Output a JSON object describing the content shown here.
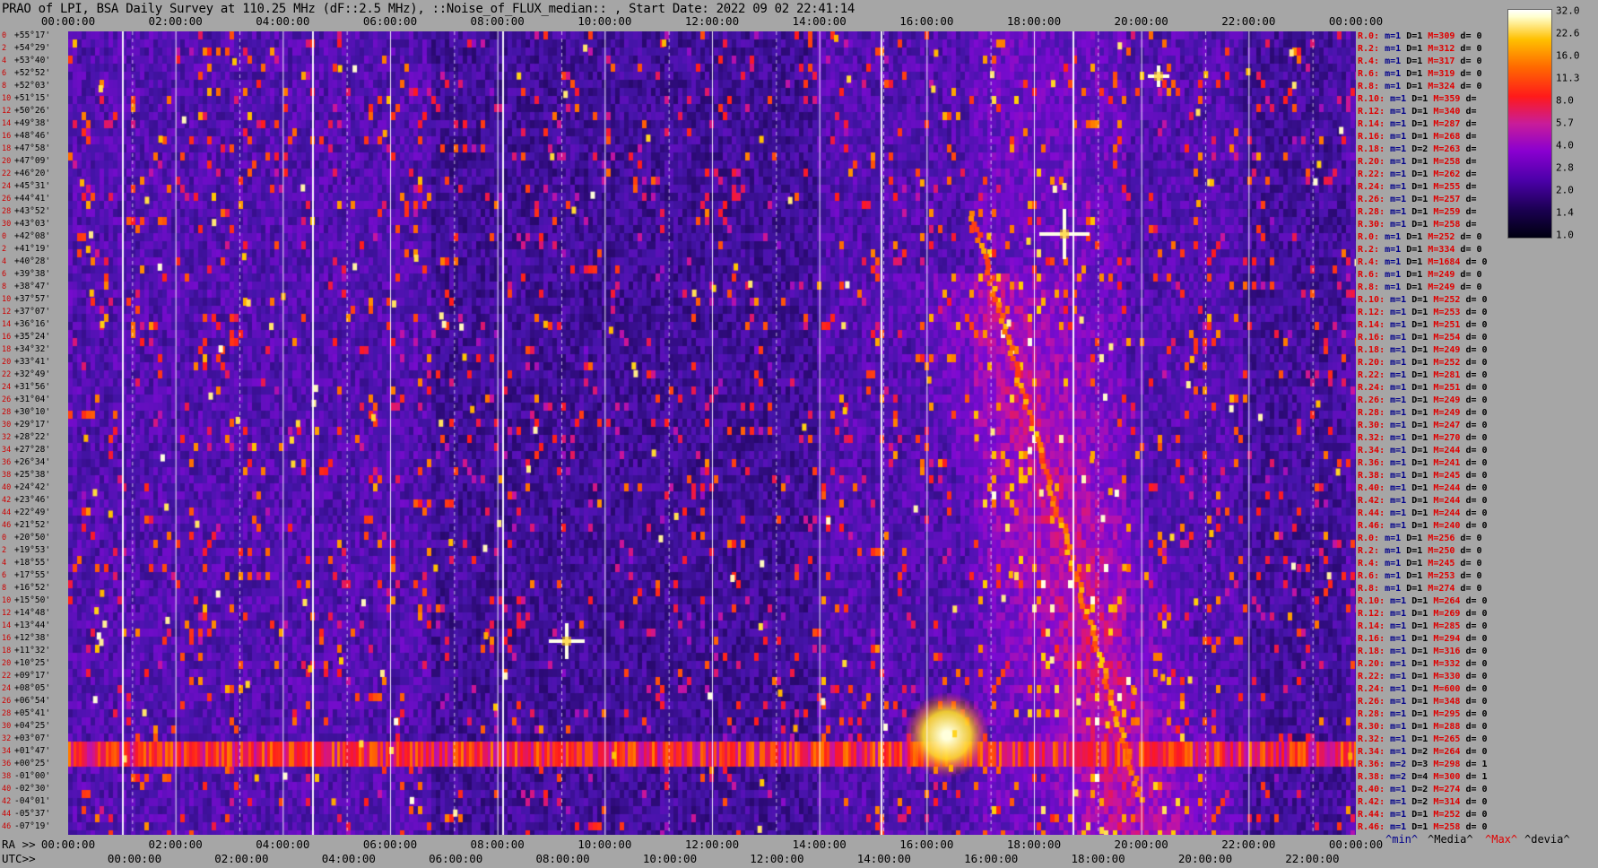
{
  "title": "PRAO of LPI, BSA Daily Survey at 110.25 MHz (dF::2.5 MHz), ::Noise_of_FLUX_median:: , Start Date: 2022 09 02 22:41:14",
  "axes": {
    "top_ticks": [
      "00:00:00",
      "02:00:00",
      "04:00:00",
      "06:00:00",
      "08:00:00",
      "10:00:00",
      "12:00:00",
      "14:00:00",
      "16:00:00",
      "18:00:00",
      "20:00:00",
      "22:00:00",
      "00:00:00"
    ],
    "ra_prefix": "RA >>",
    "ra_ticks": [
      "00:00:00",
      "02:00:00",
      "04:00:00",
      "06:00:00",
      "08:00:00",
      "10:00:00",
      "12:00:00",
      "14:00:00",
      "16:00:00",
      "18:00:00",
      "20:00:00",
      "22:00:00",
      "00:00:00"
    ],
    "utc_prefix": "UTC>>",
    "utc_ticks": [
      "00:00:00",
      "02:00:00",
      "04:00:00",
      "06:00:00",
      "08:00:00",
      "10:00:00",
      "12:00:00",
      "14:00:00",
      "16:00:00",
      "18:00:00",
      "20:00:00",
      "22:00:00"
    ]
  },
  "declinations": [
    "+55°17'",
    "+54°29'",
    "+53°40'",
    "+52°52'",
    "+52°03'",
    "+51°15'",
    "+50°26'",
    "+49°38'",
    "+48°46'",
    "+47°58'",
    "+47°09'",
    "+46°20'",
    "+45°31'",
    "+44°41'",
    "+43°52'",
    "+43°03'",
    "+42°08'",
    "+41°19'",
    "+40°28'",
    "+39°38'",
    "+38°47'",
    "+37°57'",
    "+37°07'",
    "+36°16'",
    "+35°24'",
    "+34°32'",
    "+33°41'",
    "+32°49'",
    "+31°56'",
    "+31°04'",
    "+30°10'",
    "+29°17'",
    "+28°22'",
    "+27°28'",
    "+26°34'",
    "+25°38'",
    "+24°42'",
    "+23°46'",
    "+22°49'",
    "+21°52'",
    "+20°50'",
    "+19°53'",
    "+18°55'",
    "+17°55'",
    "+16°52'",
    "+15°50'",
    "+14°48'",
    "+13°44'",
    "+12°38'",
    "+11°32'",
    "+10°25'",
    "+09°17'",
    "+08°05'",
    "+06°54'",
    "+05°41'",
    "+04°25'",
    "+03°07'",
    "+01°47'",
    "+00°25'",
    "-01°00'",
    "-02°30'",
    "-04°01'",
    "-05°37'",
    "-07°19'"
  ],
  "dec_indices": [
    "0",
    "2",
    "4",
    "6",
    "8",
    "10",
    "12",
    "14",
    "16",
    "18",
    "20",
    "22",
    "24",
    "26",
    "28",
    "30",
    "0",
    "2",
    "4",
    "6",
    "8",
    "10",
    "12",
    "14",
    "16",
    "18",
    "20",
    "22",
    "24",
    "26",
    "28",
    "30",
    "32",
    "34",
    "36",
    "38",
    "40",
    "42",
    "44",
    "46",
    "0",
    "2",
    "4",
    "6",
    "8",
    "10",
    "12",
    "14",
    "16",
    "18",
    "20",
    "22",
    "24",
    "26",
    "28",
    "30",
    "32",
    "34",
    "36",
    "38",
    "40",
    "42",
    "44",
    "46"
  ],
  "stats": [
    {
      "r": "R.0:",
      "m": "1",
      "d": "1",
      "mx": "309",
      "dv": "0"
    },
    {
      "r": "R.2:",
      "m": "1",
      "d": "1",
      "mx": "312",
      "dv": "0"
    },
    {
      "r": "R.4:",
      "m": "1",
      "d": "1",
      "mx": "317",
      "dv": "0"
    },
    {
      "r": "R.6:",
      "m": "1",
      "d": "1",
      "mx": "319",
      "dv": "0"
    },
    {
      "r": "R.8:",
      "m": "1",
      "d": "1",
      "mx": "324",
      "dv": "0"
    },
    {
      "r": "R.10:",
      "m": "1",
      "d": "1",
      "mx": "359",
      "dv": ""
    },
    {
      "r": "R.12:",
      "m": "1",
      "d": "1",
      "mx": "340",
      "dv": ""
    },
    {
      "r": "R.14:",
      "m": "1",
      "d": "1",
      "mx": "287",
      "dv": ""
    },
    {
      "r": "R.16:",
      "m": "1",
      "d": "1",
      "mx": "268",
      "dv": ""
    },
    {
      "r": "R.18:",
      "m": "1",
      "d": "2",
      "mx": "263",
      "dv": ""
    },
    {
      "r": "R.20:",
      "m": "1",
      "d": "1",
      "mx": "258",
      "dv": ""
    },
    {
      "r": "R.22:",
      "m": "1",
      "d": "1",
      "mx": "262",
      "dv": ""
    },
    {
      "r": "R.24:",
      "m": "1",
      "d": "1",
      "mx": "255",
      "dv": ""
    },
    {
      "r": "R.26:",
      "m": "1",
      "d": "1",
      "mx": "257",
      "dv": ""
    },
    {
      "r": "R.28:",
      "m": "1",
      "d": "1",
      "mx": "259",
      "dv": ""
    },
    {
      "r": "R.30:",
      "m": "1",
      "d": "1",
      "mx": "258",
      "dv": ""
    },
    {
      "r": "R.0:",
      "m": "1",
      "d": "1",
      "mx": "252",
      "dv": "0"
    },
    {
      "r": "R.2:",
      "m": "1",
      "d": "1",
      "mx": "334",
      "dv": "0"
    },
    {
      "r": "R.4:",
      "m": "1",
      "d": "1",
      "mx": "1684",
      "dv": "0"
    },
    {
      "r": "R.6:",
      "m": "1",
      "d": "1",
      "mx": "249",
      "dv": "0"
    },
    {
      "r": "R.8:",
      "m": "1",
      "d": "1",
      "mx": "249",
      "dv": "0"
    },
    {
      "r": "R.10:",
      "m": "1",
      "d": "1",
      "mx": "252",
      "dv": "0"
    },
    {
      "r": "R.12:",
      "m": "1",
      "d": "1",
      "mx": "253",
      "dv": "0"
    },
    {
      "r": "R.14:",
      "m": "1",
      "d": "1",
      "mx": "251",
      "dv": "0"
    },
    {
      "r": "R.16:",
      "m": "1",
      "d": "1",
      "mx": "254",
      "dv": "0"
    },
    {
      "r": "R.18:",
      "m": "1",
      "d": "1",
      "mx": "249",
      "dv": "0"
    },
    {
      "r": "R.20:",
      "m": "1",
      "d": "1",
      "mx": "252",
      "dv": "0"
    },
    {
      "r": "R.22:",
      "m": "1",
      "d": "1",
      "mx": "281",
      "dv": "0"
    },
    {
      "r": "R.24:",
      "m": "1",
      "d": "1",
      "mx": "251",
      "dv": "0"
    },
    {
      "r": "R.26:",
      "m": "1",
      "d": "1",
      "mx": "249",
      "dv": "0"
    },
    {
      "r": "R.28:",
      "m": "1",
      "d": "1",
      "mx": "249",
      "dv": "0"
    },
    {
      "r": "R.30:",
      "m": "1",
      "d": "1",
      "mx": "247",
      "dv": "0"
    },
    {
      "r": "R.32:",
      "m": "1",
      "d": "1",
      "mx": "270",
      "dv": "0"
    },
    {
      "r": "R.34:",
      "m": "1",
      "d": "1",
      "mx": "244",
      "dv": "0"
    },
    {
      "r": "R.36:",
      "m": "1",
      "d": "1",
      "mx": "241",
      "dv": "0"
    },
    {
      "r": "R.38:",
      "m": "1",
      "d": "1",
      "mx": "245",
      "dv": "0"
    },
    {
      "r": "R.40:",
      "m": "1",
      "d": "1",
      "mx": "244",
      "dv": "0"
    },
    {
      "r": "R.42:",
      "m": "1",
      "d": "1",
      "mx": "244",
      "dv": "0"
    },
    {
      "r": "R.44:",
      "m": "1",
      "d": "1",
      "mx": "244",
      "dv": "0"
    },
    {
      "r": "R.46:",
      "m": "1",
      "d": "1",
      "mx": "240",
      "dv": "0"
    },
    {
      "r": "R.0:",
      "m": "1",
      "d": "1",
      "mx": "256",
      "dv": "0"
    },
    {
      "r": "R.2:",
      "m": "1",
      "d": "1",
      "mx": "250",
      "dv": "0"
    },
    {
      "r": "R.4:",
      "m": "1",
      "d": "1",
      "mx": "245",
      "dv": "0"
    },
    {
      "r": "R.6:",
      "m": "1",
      "d": "1",
      "mx": "253",
      "dv": "0"
    },
    {
      "r": "R.8:",
      "m": "1",
      "d": "1",
      "mx": "274",
      "dv": "0"
    },
    {
      "r": "R.10:",
      "m": "1",
      "d": "1",
      "mx": "264",
      "dv": "0"
    },
    {
      "r": "R.12:",
      "m": "1",
      "d": "1",
      "mx": "269",
      "dv": "0"
    },
    {
      "r": "R.14:",
      "m": "1",
      "d": "1",
      "mx": "285",
      "dv": "0"
    },
    {
      "r": "R.16:",
      "m": "1",
      "d": "1",
      "mx": "294",
      "dv": "0"
    },
    {
      "r": "R.18:",
      "m": "1",
      "d": "1",
      "mx": "316",
      "dv": "0"
    },
    {
      "r": "R.20:",
      "m": "1",
      "d": "1",
      "mx": "332",
      "dv": "0"
    },
    {
      "r": "R.22:",
      "m": "1",
      "d": "1",
      "mx": "330",
      "dv": "0"
    },
    {
      "r": "R.24:",
      "m": "1",
      "d": "1",
      "mx": "600",
      "dv": "0"
    },
    {
      "r": "R.26:",
      "m": "1",
      "d": "1",
      "mx": "348",
      "dv": "0"
    },
    {
      "r": "R.28:",
      "m": "1",
      "d": "1",
      "mx": "295",
      "dv": "0"
    },
    {
      "r": "R.30:",
      "m": "1",
      "d": "1",
      "mx": "288",
      "dv": "0"
    },
    {
      "r": "R.32:",
      "m": "1",
      "d": "1",
      "mx": "265",
      "dv": "0"
    },
    {
      "r": "R.34:",
      "m": "1",
      "d": "2",
      "mx": "264",
      "dv": "0"
    },
    {
      "r": "R.36:",
      "m": "2",
      "d": "3",
      "mx": "298",
      "dv": "1"
    },
    {
      "r": "R.38:",
      "m": "2",
      "d": "4",
      "mx": "300",
      "dv": "1"
    },
    {
      "r": "R.40:",
      "m": "1",
      "d": "2",
      "mx": "274",
      "dv": "0"
    },
    {
      "r": "R.42:",
      "m": "1",
      "d": "2",
      "mx": "314",
      "dv": "0"
    },
    {
      "r": "R.44:",
      "m": "1",
      "d": "1",
      "mx": "252",
      "dv": "0"
    },
    {
      "r": "R.46:",
      "m": "1",
      "d": "1",
      "mx": "258",
      "dv": "0"
    }
  ],
  "colorbar": {
    "ticks": [
      "32.0",
      "22.6",
      "16.0",
      "11.3",
      "8.0",
      "5.7",
      "4.0",
      "2.8",
      "2.0",
      "1.4",
      "1.0"
    ]
  },
  "legend": {
    "min": "^min^",
    "median": "^Media^",
    "max": "^Max^",
    "devia": "^devia^"
  },
  "colors": {
    "background": "#a6a6a6",
    "accent_red": "#e00000",
    "accent_blue": "#00008b"
  },
  "chart_data": {
    "type": "heatmap",
    "title": "PRAO of LPI, BSA Daily Survey at 110.25 MHz (dF::2.5 MHz), ::Noise_of_FLUX_median:: , Start Date: 2022 09 02 22:41:14",
    "xlabel": "RA / UTC",
    "x_ticks": [
      "00:00:00",
      "02:00:00",
      "04:00:00",
      "06:00:00",
      "08:00:00",
      "10:00:00",
      "12:00:00",
      "14:00:00",
      "16:00:00",
      "18:00:00",
      "20:00:00",
      "22:00:00",
      "00:00:00"
    ],
    "y_ticks": [
      "+55°17'",
      "-07°19'"
    ],
    "colorscale_range": [
      1.0,
      32.0
    ],
    "colorscale": "log",
    "grid": true
  }
}
